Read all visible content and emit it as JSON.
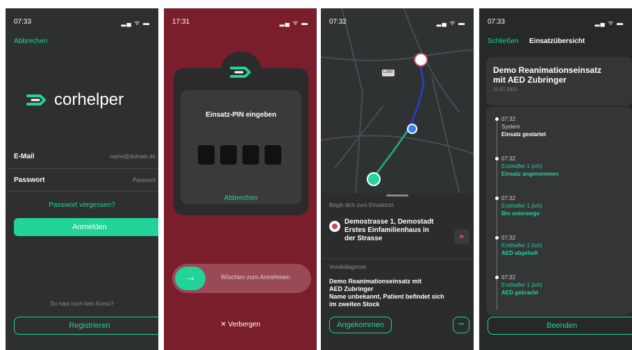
{
  "screen1": {
    "time": "07:33",
    "status_icons": "▂▄ ᯤ ▬",
    "cancel": "Abbrechen",
    "logo_text": "corhelper",
    "email_label": "E-Mail",
    "email_placeholder": "name@domain.de",
    "password_label": "Passwort",
    "password_placeholder": "Passwort",
    "forgot": "Passwort vergessen?",
    "login": "Anmelden",
    "no_account": "Du hast noch kein Konto?",
    "register": "Registrieren"
  },
  "screen2": {
    "time": "17:31",
    "status_icons": "▂▄ ᯤ ▬",
    "pin_title": "Einsatz-PIN eingeben",
    "cancel": "Abbrechen",
    "swipe": "Wischen zum Annehmen",
    "hide": "✕ Verbergen"
  },
  "screen3": {
    "time": "07:32",
    "status_icons": "▂▄ ᯤ ▬",
    "map_road_label": "L359",
    "goto_heading": "Begib dich zum Einsatzort",
    "address_line1": "Demostrasse 1, Demostadt",
    "address_line2": "Erstes Einfamilienhaus in",
    "address_line3": "der Strasse",
    "diag_heading": "Vorabdiagnose",
    "diag_line1": "Demo Reanimationseinsatz mit",
    "diag_line2": "AED Zubringer",
    "diag_line3": "Name unbekannt, Patient befindet sich",
    "diag_line4": "im zweiten Stock",
    "arrived": "Angekommen",
    "more": "•••"
  },
  "screen4": {
    "time": "07:33",
    "status_icons": "▂▄ ᯤ ▬",
    "close": "Schließen",
    "title": "Einsatzübersicht",
    "case_title_line1": "Demo Reanimationseinsatz",
    "case_title_line2": "mit AED Zubringer",
    "date": "21.07.2021",
    "timeline": [
      {
        "time": "07:32",
        "who": "System",
        "what": "Einsatz gestartet",
        "green": false
      },
      {
        "time": "07:32",
        "who": "Ersthelfer 1 (ich)",
        "what": "Einsatz angenommen",
        "green": true
      },
      {
        "time": "07:32",
        "who": "Ersthelfer 1 (ich)",
        "what": "Bin unterwegs",
        "green": true
      },
      {
        "time": "07:32",
        "who": "Ersthelfer 1 (ich)",
        "what": "AED abgeholt",
        "green": true
      },
      {
        "time": "07:32",
        "who": "Ersthelfer 1 (ich)",
        "what": "AED gebracht",
        "green": true
      }
    ],
    "finish": "Beenden"
  },
  "colors": {
    "accent": "#22d39a",
    "pin_screen_bg": "#7a1e2c",
    "route_blue": "#2b3db8"
  }
}
